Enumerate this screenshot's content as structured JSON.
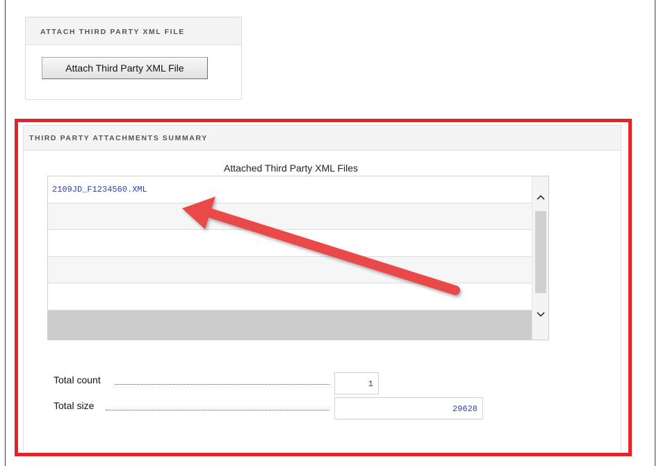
{
  "attach_panel": {
    "header": "ATTACH THIRD PARTY XML FILE",
    "button_label": "Attach Third Party XML File"
  },
  "summary_panel": {
    "header": "THIRD PARTY ATTACHMENTS SUMMARY",
    "list_title": "Attached Third Party XML Files",
    "files": [
      "2109JD_F1234560.XML",
      "",
      "",
      "",
      "",
      ""
    ],
    "scroll_up_icon": "chevron-up-icon",
    "scroll_down_icon": "chevron-down-icon"
  },
  "totals": {
    "count_label": "Total count",
    "count_value": "1",
    "size_label": "Total size",
    "size_value": "29628"
  },
  "annotation": {
    "highlight_color": "#e3222a",
    "arrow_color": "#e94a4a"
  },
  "colors": {
    "value_text": "#2a3fb8"
  }
}
